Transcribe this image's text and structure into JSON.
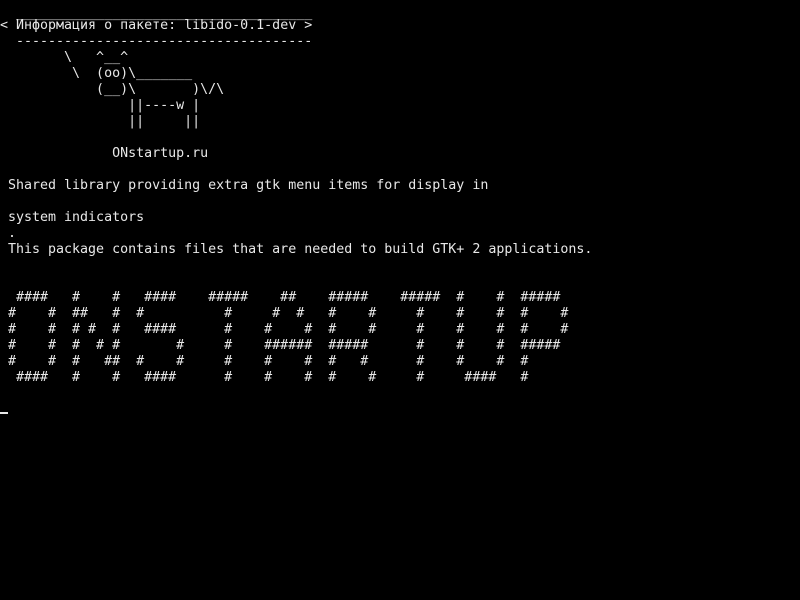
{
  "cowsay": {
    "border_top": " _____________________________________",
    "message": "< Информация о пакете: libido-0.1-dev >",
    "border_bottom": " -------------------------------------",
    "cow": [
      "       \\   ^__^",
      "        \\  (oo)\\_______",
      "           (__)\\       )\\/\\",
      "               ||----w |",
      "               ||     ||"
    ],
    "credit": "             ONstartup.ru"
  },
  "description": {
    "line1": "Shared library providing extra gtk menu items for display in",
    "line2": "system indicators",
    "line3": ".",
    "line4": "This package contains files that are needed to build GTK+ 2 applications."
  },
  "banner": {
    "rows": [
      " ####   #    #   ####    #####    ##    #####    #####  #    #  #####",
      "#    #  ##   #  #          #     #  #   #    #     #    #    #  #    #",
      "#    #  # #  #   ####      #    #    #  #    #     #    #    #  #    #",
      "#    #  #  # #       #     #    ######  #####      #    #    #  #####",
      "#    #  #   ##  #    #     #    #    #  #   #      #    #    #  #",
      " ####   #    #   ####      #    #    #  #    #     #     ####   #"
    ]
  },
  "colors": {
    "background": "#000000",
    "foreground": "#e8e8e8"
  }
}
